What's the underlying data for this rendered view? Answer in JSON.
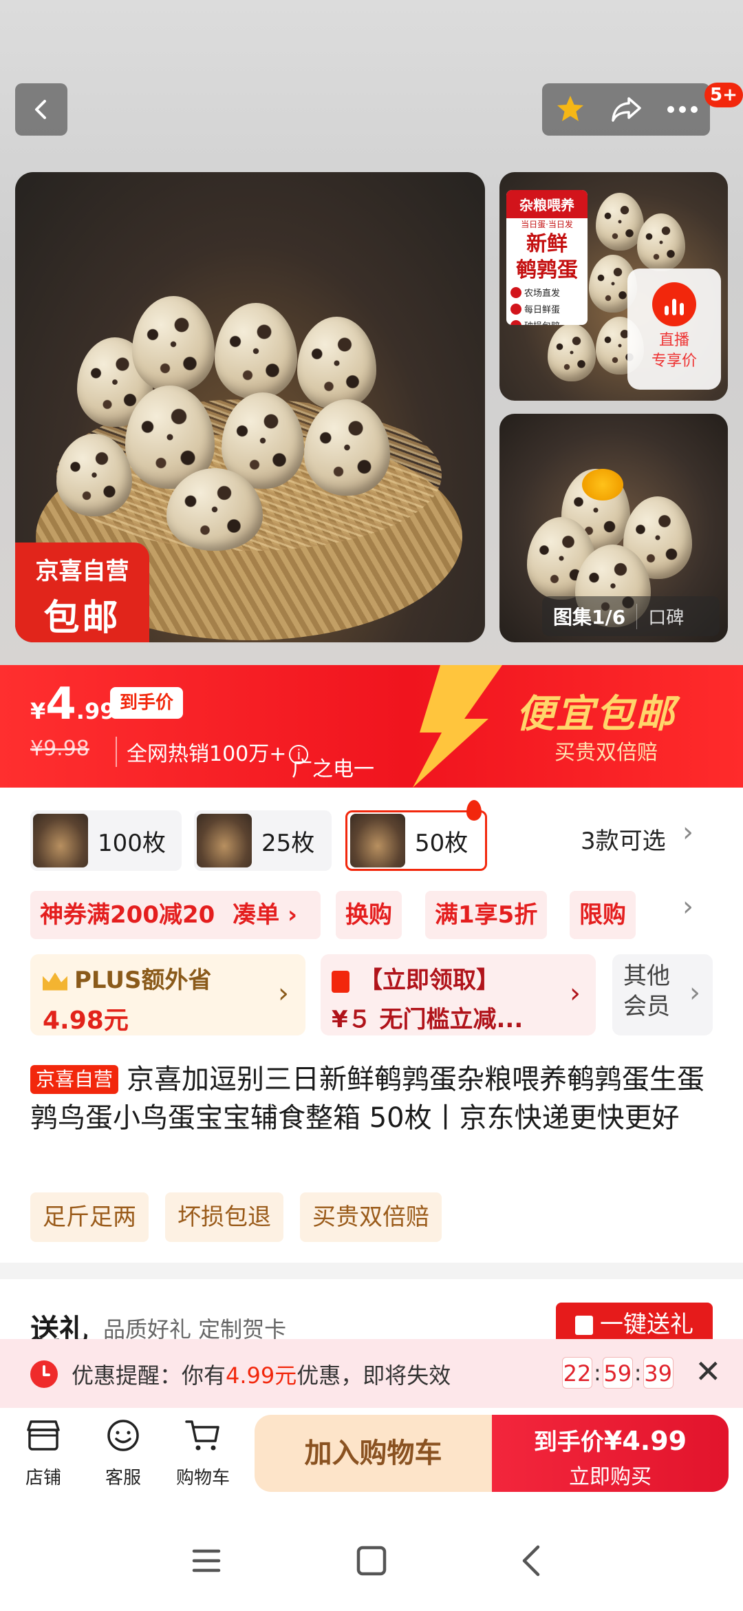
{
  "top": {
    "badge_count": "5+"
  },
  "gallery": {
    "main_badge_line1": "京喜自营",
    "main_badge_line2": "包邮",
    "promo_header": "杂粮喂养",
    "promo_sub": "当日蛋·当日发",
    "promo_big1": "新鲜",
    "promo_big2": "鹌鹑蛋",
    "promo_checks": [
      "农场直发",
      "每日鲜蛋",
      "破损包赔"
    ],
    "live_label1": "直播",
    "live_label2": "专享价",
    "album_label": "图集1/6",
    "reviews_label": "口碑"
  },
  "price": {
    "currency": "¥",
    "integer": "4",
    "decimal": ".99",
    "tag": "到手价",
    "original": "¥9.98",
    "hot_sales": "全网热销100万+",
    "promo_title": "便宜包邮",
    "promo_sub": "买贵双倍赔",
    "ad_word": "广之电一"
  },
  "specs": {
    "options": [
      "100枚",
      "25枚",
      "50枚"
    ],
    "selected": "50枚",
    "more": "3款可选"
  },
  "coupons": [
    "神券满200减20",
    "凑单 ›",
    "换购",
    "满1享5折",
    "限购"
  ],
  "cards": {
    "plus_title": "PLUS额外省",
    "plus_value": "4.98元",
    "gift_title": "【立即领取】",
    "gift_value": "¥５ 无门槛立减...",
    "member_line1": "其他",
    "member_line2": "会员"
  },
  "product": {
    "tag": "京喜自营",
    "title": "京喜加逗别三日新鲜鹌鹑蛋杂粮喂养鹌鹑蛋生蛋鹑鸟蛋小鸟蛋宝宝辅食整箱 50枚丨京东快递更快更好",
    "features": [
      "足斤足两",
      "坏损包退",
      "买贵双倍赔"
    ]
  },
  "gift_section": {
    "heading": "送礼",
    "sub": "品质好礼 定制贺卡",
    "button": "一键送礼"
  },
  "reminder": {
    "prefix": "优惠提醒：你有",
    "amount": "4.99元",
    "suffix": "优惠，即将失效",
    "hh": "22",
    "mm": "59",
    "ss": "39"
  },
  "bottom": {
    "store": "店铺",
    "service": "客服",
    "cart": "购物车",
    "add_cart": "加入购物车",
    "buy_price_label": "到手价",
    "buy_price": "¥4.99",
    "buy_now": "立即购买"
  },
  "colors": {
    "accent": "#f2270c",
    "cart_bg": "#fde4c9",
    "reminder_bg": "#fde7ea"
  }
}
